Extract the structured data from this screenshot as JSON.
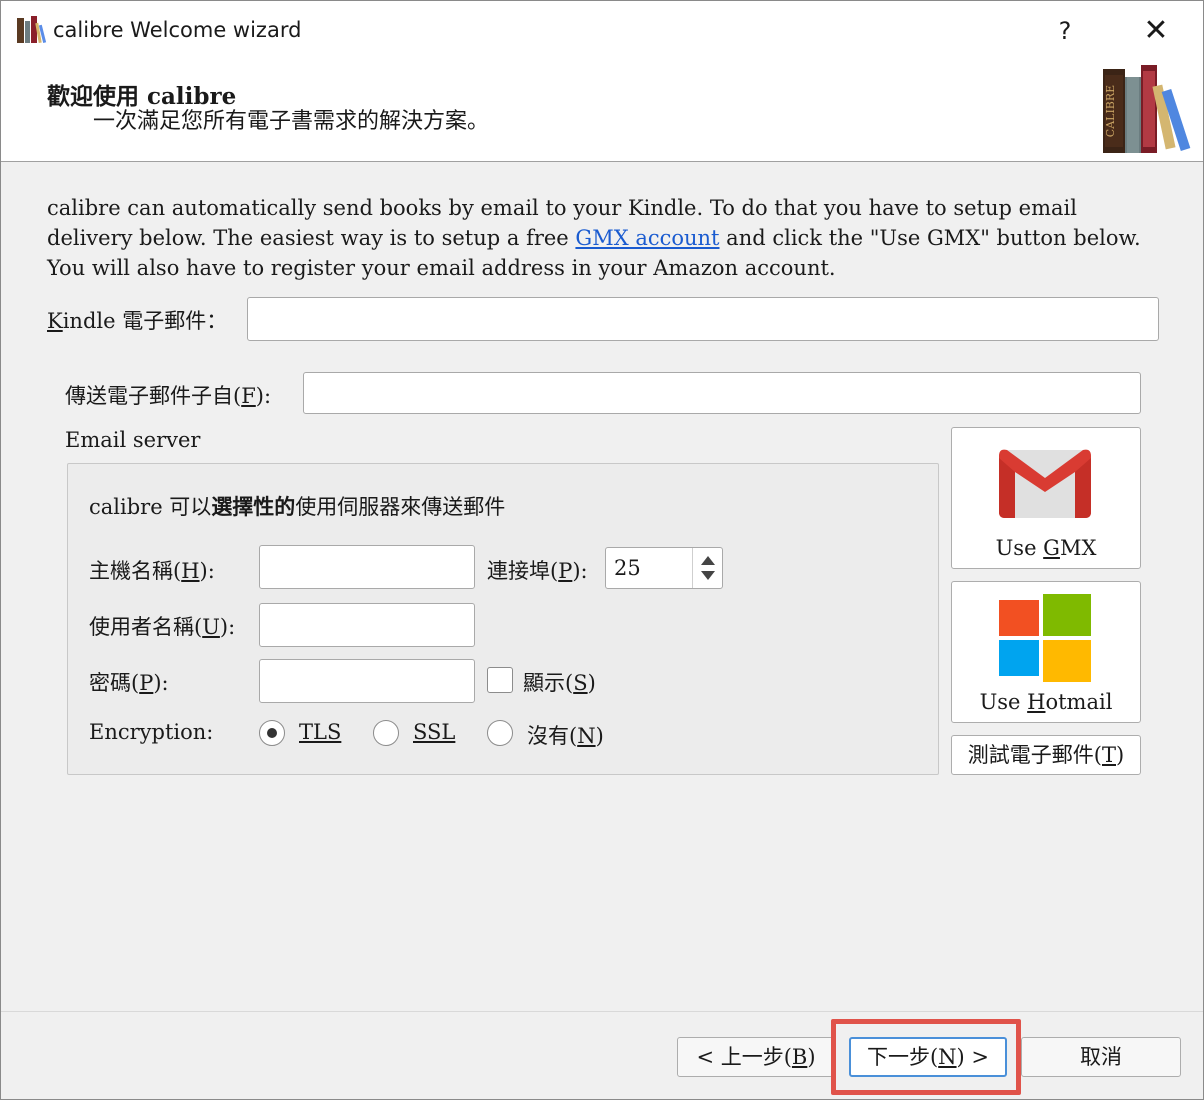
{
  "window": {
    "title": "calibre Welcome wizard",
    "help_label": "?",
    "close_label": "✕"
  },
  "header": {
    "title": "歡迎使用 calibre",
    "subtitle": "一次滿足您所有電子書需求的解決方案。",
    "logo_text": "CALIBRE"
  },
  "intro": {
    "text_before_link": "calibre can automatically send books by email to your Kindle. To do that you have to setup email delivery below. The easiest way is to setup a free ",
    "link_text": "GMX account",
    "text_after_link": " and click the \"Use GMX\" button below. You will also have to register your email address in your Amazon account."
  },
  "kindle_email": {
    "label_first": "K",
    "label_rest": "indle 電子郵件：",
    "value": ""
  },
  "from_email": {
    "label_pre": "傳送電子郵件子自(",
    "label_key": "F",
    "label_post": "):",
    "value": ""
  },
  "email_server": {
    "group_label": "Email server",
    "desc_pre": "calibre 可以",
    "desc_bold": "選擇性的",
    "desc_post": "使用伺服器來傳送郵件",
    "hostname": {
      "label_pre": "主機名稱(",
      "key": "H",
      "label_post": "):",
      "value": ""
    },
    "port": {
      "label_pre": "連接埠(",
      "key": "P",
      "label_post": "):",
      "value": "25"
    },
    "username": {
      "label_pre": "使用者名稱(",
      "key": "U",
      "label_post": "):",
      "value": ""
    },
    "password": {
      "label_pre": "密碼(",
      "key": "P",
      "label_post": "):",
      "value": ""
    },
    "show": {
      "label_pre": "顯示(",
      "key": "S",
      "label_post": ")",
      "checked": false
    },
    "encryption": {
      "label": "Encryption:",
      "options": [
        {
          "label": "TLS",
          "selected": true
        },
        {
          "label": "SSL",
          "selected": false
        },
        {
          "label_pre": "沒有(",
          "key": "N",
          "label_post": ")",
          "selected": false
        }
      ]
    }
  },
  "gmx_button": {
    "label_pre": "Use ",
    "key": "G",
    "label_post": "MX",
    "icon": "gmail-icon"
  },
  "hotmail_button": {
    "label_pre": "Use ",
    "key": "H",
    "label_post": "otmail",
    "icon": "windows-icon"
  },
  "test_button": {
    "label_pre": "測試電子郵件(",
    "key": "T",
    "label_post": ")"
  },
  "footer": {
    "back": {
      "label_pre": "< 上一步(",
      "key": "B",
      "label_post": ")"
    },
    "next": {
      "label_pre": "下一步(",
      "key": "N",
      "label_post": ") >"
    },
    "cancel": {
      "label": "取消"
    }
  },
  "colors": {
    "link": "#1a5bd0",
    "highlight": "#e0534a",
    "next_border": "#4a90d9"
  }
}
